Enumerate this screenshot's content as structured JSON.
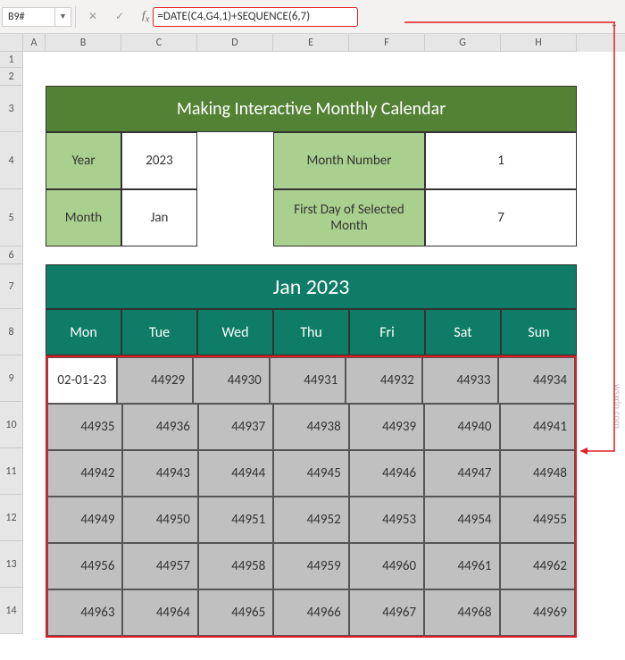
{
  "name_box": "B9#",
  "formula": "=DATE(C4,G4,1)+SEQUENCE(6,7)",
  "columns": [
    "A",
    "B",
    "C",
    "D",
    "E",
    "F",
    "G",
    "H"
  ],
  "rows": [
    "1",
    "2",
    "3",
    "4",
    "5",
    "6",
    "7",
    "8",
    "9",
    "10",
    "11",
    "12",
    "13",
    "14"
  ],
  "title": "Making Interactive Monthly Calendar",
  "info_left": {
    "r1_label": "Year",
    "r1_val": "2023",
    "r2_label": "Month",
    "r2_val": "Jan"
  },
  "info_right": {
    "r1_label": "Month Number",
    "r1_val": "1",
    "r2_label": "First Day of Selected Month",
    "r2_val": "7"
  },
  "calendar": {
    "title": "Jan 2023",
    "days": [
      "Mon",
      "Tue",
      "Wed",
      "Thu",
      "Fri",
      "Sat",
      "Sun"
    ],
    "active_cell": "02-01-23",
    "grid": [
      [
        "02-01-23",
        "44929",
        "44930",
        "44931",
        "44932",
        "44933",
        "44934"
      ],
      [
        "44935",
        "44936",
        "44937",
        "44938",
        "44939",
        "44940",
        "44941"
      ],
      [
        "44942",
        "44943",
        "44944",
        "44945",
        "44946",
        "44947",
        "44948"
      ],
      [
        "44949",
        "44950",
        "44951",
        "44952",
        "44953",
        "44954",
        "44955"
      ],
      [
        "44956",
        "44957",
        "44958",
        "44959",
        "44960",
        "44961",
        "44962"
      ],
      [
        "44963",
        "44964",
        "44965",
        "44966",
        "44967",
        "44968",
        "44969"
      ]
    ]
  },
  "watermark": "wsxdn.com"
}
